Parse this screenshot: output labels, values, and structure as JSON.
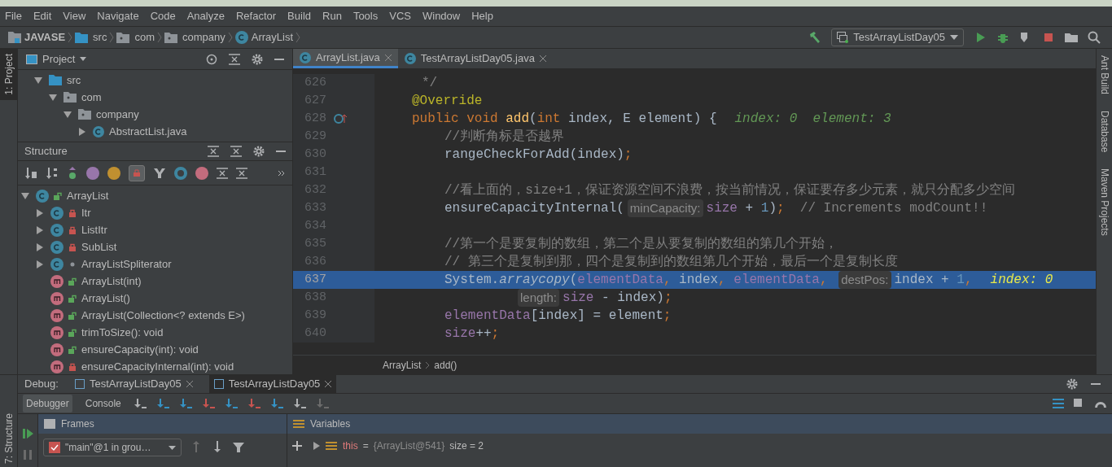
{
  "menu": [
    "File",
    "Edit",
    "View",
    "Navigate",
    "Code",
    "Analyze",
    "Refactor",
    "Build",
    "Run",
    "Tools",
    "VCS",
    "Window",
    "Help"
  ],
  "breadcrumb": [
    "JAVASE",
    "src",
    "com",
    "company",
    "ArrayList"
  ],
  "run_config": "TestArrayListDay05",
  "left_strip": {
    "top": "1: Project",
    "bottom": "7: Structure"
  },
  "project": {
    "title": "Project",
    "tree": [
      {
        "label": "src",
        "kind": "source",
        "expanded": true,
        "children": [
          {
            "label": "com",
            "kind": "package",
            "expanded": true,
            "children": [
              {
                "label": "company",
                "kind": "package",
                "expanded": true,
                "children": [
                  {
                    "label": "AbstractList.java",
                    "kind": "file",
                    "expanded": false
                  }
                ]
              }
            ]
          }
        ]
      }
    ]
  },
  "structure": {
    "title": "Structure",
    "tree": [
      {
        "label": "ArrayList",
        "kind": "class-public",
        "expanded": true,
        "children": [
          {
            "label": "Itr",
            "kind": "class-private",
            "expanded": false
          },
          {
            "label": "ListItr",
            "kind": "class-private",
            "expanded": false
          },
          {
            "label": "SubList",
            "kind": "class-private",
            "expanded": false
          },
          {
            "label": "ArrayListSpliterator",
            "kind": "class-package",
            "expanded": false
          },
          {
            "label": "ArrayList(int)",
            "kind": "method-public"
          },
          {
            "label": "ArrayList()",
            "kind": "method-public"
          },
          {
            "label": "ArrayList(Collection<? extends E>)",
            "kind": "method-public"
          },
          {
            "label": "trimToSize(): void",
            "kind": "method-public"
          },
          {
            "label": "ensureCapacity(int): void",
            "kind": "method-public"
          },
          {
            "label": "ensureCapacityInternal(int): void",
            "kind": "method-private"
          }
        ]
      }
    ]
  },
  "editor_tabs": [
    {
      "label": "ArrayList.java",
      "selected": true
    },
    {
      "label": "TestArrayListDay05.java",
      "selected": false
    }
  ],
  "code": [
    {
      "number": "626",
      "kind": "doc",
      "highlighted": false,
      "tokens": [
        {
          "kind": "comment",
          "text": "*/"
        }
      ]
    },
    {
      "number": "627",
      "kind": "method",
      "highlighted": false,
      "tokens": [
        {
          "kind": "annotation",
          "text": "@Override"
        }
      ]
    },
    {
      "number": "628",
      "kind": "method",
      "highlighted": false,
      "tokens": [
        {
          "kind": "keyword",
          "text": "public void "
        },
        {
          "kind": "method",
          "text": "add"
        },
        {
          "kind": "plain",
          "text": "("
        },
        {
          "kind": "keyword",
          "text": "int"
        },
        {
          "kind": "plain",
          "text": " index, "
        },
        {
          "kind": "type",
          "text": "E"
        },
        {
          "kind": "plain",
          "text": " element) {"
        },
        {
          "kind": "debug",
          "text": "index: 0  element: 3"
        }
      ]
    },
    {
      "number": "629",
      "kind": "body",
      "highlighted": false,
      "tokens": [
        {
          "kind": "comment",
          "text": "//判断角标是否越界"
        }
      ]
    },
    {
      "number": "630",
      "kind": "body",
      "highlighted": false,
      "tokens": [
        {
          "kind": "plain",
          "text": "rangeCheckForAdd(index)"
        },
        {
          "kind": "keyword",
          "text": ";"
        }
      ]
    },
    {
      "number": "631",
      "kind": "body",
      "highlighted": false
    },
    {
      "number": "632",
      "kind": "body",
      "highlighted": false,
      "tokens": [
        {
          "kind": "comment",
          "text": "//看上面的，size+1，保证资源空间不浪费，按当前情况，保证要存多少元素，就只分配多少空间"
        }
      ]
    },
    {
      "number": "633",
      "kind": "body",
      "highlighted": false,
      "tokens": [
        {
          "kind": "plain",
          "text": "ensureCapacityInternal("
        },
        {
          "kind": "hint",
          "text": "minCapacity:"
        },
        {
          "kind": "field",
          "text": "size"
        },
        {
          "kind": "plain",
          "text": " + "
        },
        {
          "kind": "number",
          "text": "1"
        },
        {
          "kind": "plain",
          "text": ")"
        },
        {
          "kind": "keyword",
          "text": ";"
        },
        {
          "kind": "comment",
          "text": "  // Increments modCount!!"
        }
      ]
    },
    {
      "number": "634",
      "kind": "body",
      "highlighted": false
    },
    {
      "number": "635",
      "kind": "body",
      "highlighted": false,
      "tokens": [
        {
          "kind": "comment",
          "text": "//第一个是要复制的数组，第二个是从要复制的数组的第几个开始，"
        }
      ]
    },
    {
      "number": "636",
      "kind": "body",
      "highlighted": false,
      "tokens": [
        {
          "kind": "comment",
          "text": "// 第三个是复制到那，四个是复制到的数组第几个开始，最后一个是复制长度"
        }
      ]
    },
    {
      "number": "637",
      "kind": "body",
      "highlighted": true,
      "tokens": [
        {
          "kind": "plain",
          "text": "System."
        },
        {
          "kind": "italic",
          "text": "arraycopy"
        },
        {
          "kind": "plain",
          "text": "("
        },
        {
          "kind": "field",
          "text": "elementData"
        },
        {
          "kind": "keyword",
          "text": ", "
        },
        {
          "kind": "plain",
          "text": "index"
        },
        {
          "kind": "keyword",
          "text": ", "
        },
        {
          "kind": "field",
          "text": "elementData"
        },
        {
          "kind": "keyword",
          "text": ", "
        },
        {
          "kind": "hint",
          "text": "destPos:"
        },
        {
          "kind": "plain",
          "text": "index + "
        },
        {
          "kind": "number",
          "text": "1"
        },
        {
          "kind": "keyword",
          "text": ","
        },
        {
          "kind": "debug",
          "text": "index: 0"
        }
      ]
    },
    {
      "number": "638",
      "kind": "continuation",
      "highlighted": false,
      "tokens": [
        {
          "kind": "hint",
          "text": "length:"
        },
        {
          "kind": "field",
          "text": "size"
        },
        {
          "kind": "plain",
          "text": " - index)"
        },
        {
          "kind": "keyword",
          "text": ";"
        }
      ]
    },
    {
      "number": "639",
      "kind": "body",
      "highlighted": false,
      "tokens": [
        {
          "kind": "field",
          "text": "elementData"
        },
        {
          "kind": "plain",
          "text": "[index] = element"
        },
        {
          "kind": "keyword",
          "text": ";"
        }
      ]
    },
    {
      "number": "640",
      "kind": "body",
      "highlighted": false,
      "tokens": [
        {
          "kind": "field",
          "text": "size"
        },
        {
          "kind": "plain",
          "text": "++"
        },
        {
          "kind": "keyword",
          "text": ";"
        }
      ]
    }
  ],
  "editor_breadcrumb": [
    "ArrayList",
    "add()"
  ],
  "right_strip": [
    "Ant Build",
    "Database",
    "Maven Projects"
  ],
  "debug": {
    "label": "Debug:",
    "tabs": [
      {
        "label": "TestArrayListDay05",
        "selected": false
      },
      {
        "label": "TestArrayListDay05",
        "selected": true
      }
    ],
    "subtabs": [
      {
        "label": "Debugger",
        "selected": true
      },
      {
        "label": "Console",
        "selected": false
      }
    ],
    "frames": {
      "title": "Frames",
      "thread": "\"main\"@1 in grou…"
    },
    "variables": {
      "title": "Variables",
      "rows": [
        {
          "name": "this",
          "eq": "=",
          "value": "{ArrayList@541}",
          "detail": "size = 2"
        }
      ]
    }
  }
}
